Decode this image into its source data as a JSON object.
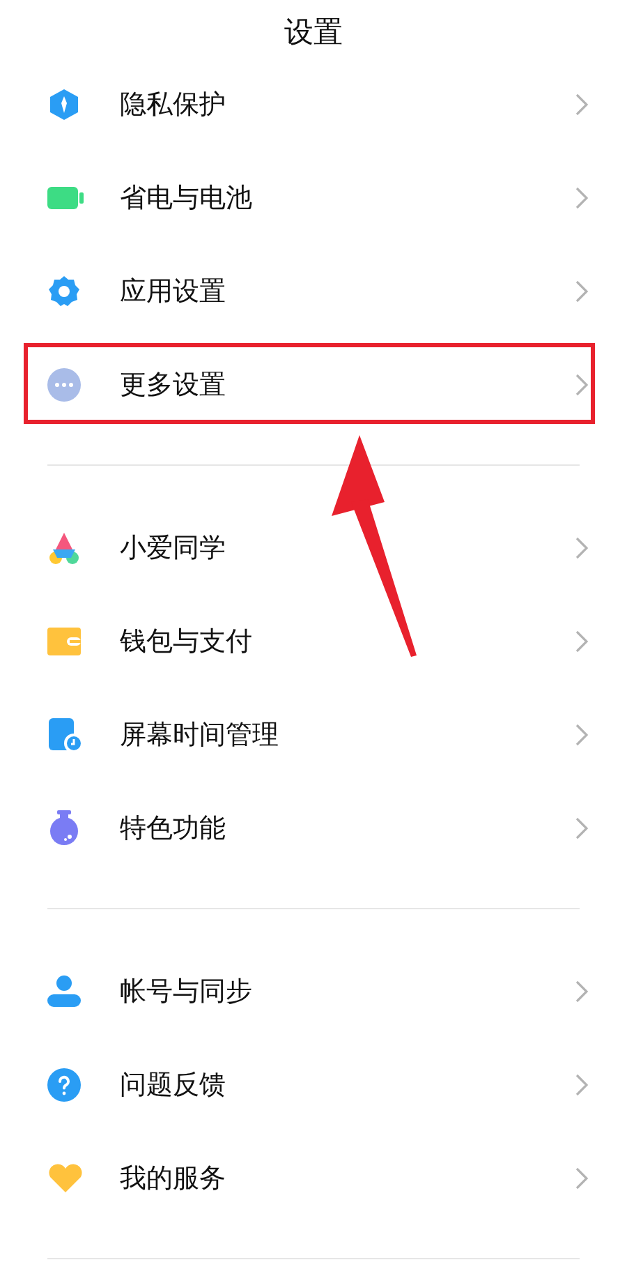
{
  "title": "设置",
  "groups": [
    {
      "items": [
        {
          "label": "隐私保护",
          "highlighted": false
        },
        {
          "label": "省电与电池",
          "highlighted": false
        },
        {
          "label": "应用设置",
          "highlighted": false
        },
        {
          "label": "更多设置",
          "highlighted": true
        }
      ]
    },
    {
      "items": [
        {
          "label": "小爱同学",
          "highlighted": false
        },
        {
          "label": "钱包与支付",
          "highlighted": false
        },
        {
          "label": "屏幕时间管理",
          "highlighted": false
        },
        {
          "label": "特色功能",
          "highlighted": false
        }
      ]
    },
    {
      "items": [
        {
          "label": "帐号与同步",
          "highlighted": false
        },
        {
          "label": "问题反馈",
          "highlighted": false
        },
        {
          "label": "我的服务",
          "highlighted": false
        }
      ]
    }
  ]
}
